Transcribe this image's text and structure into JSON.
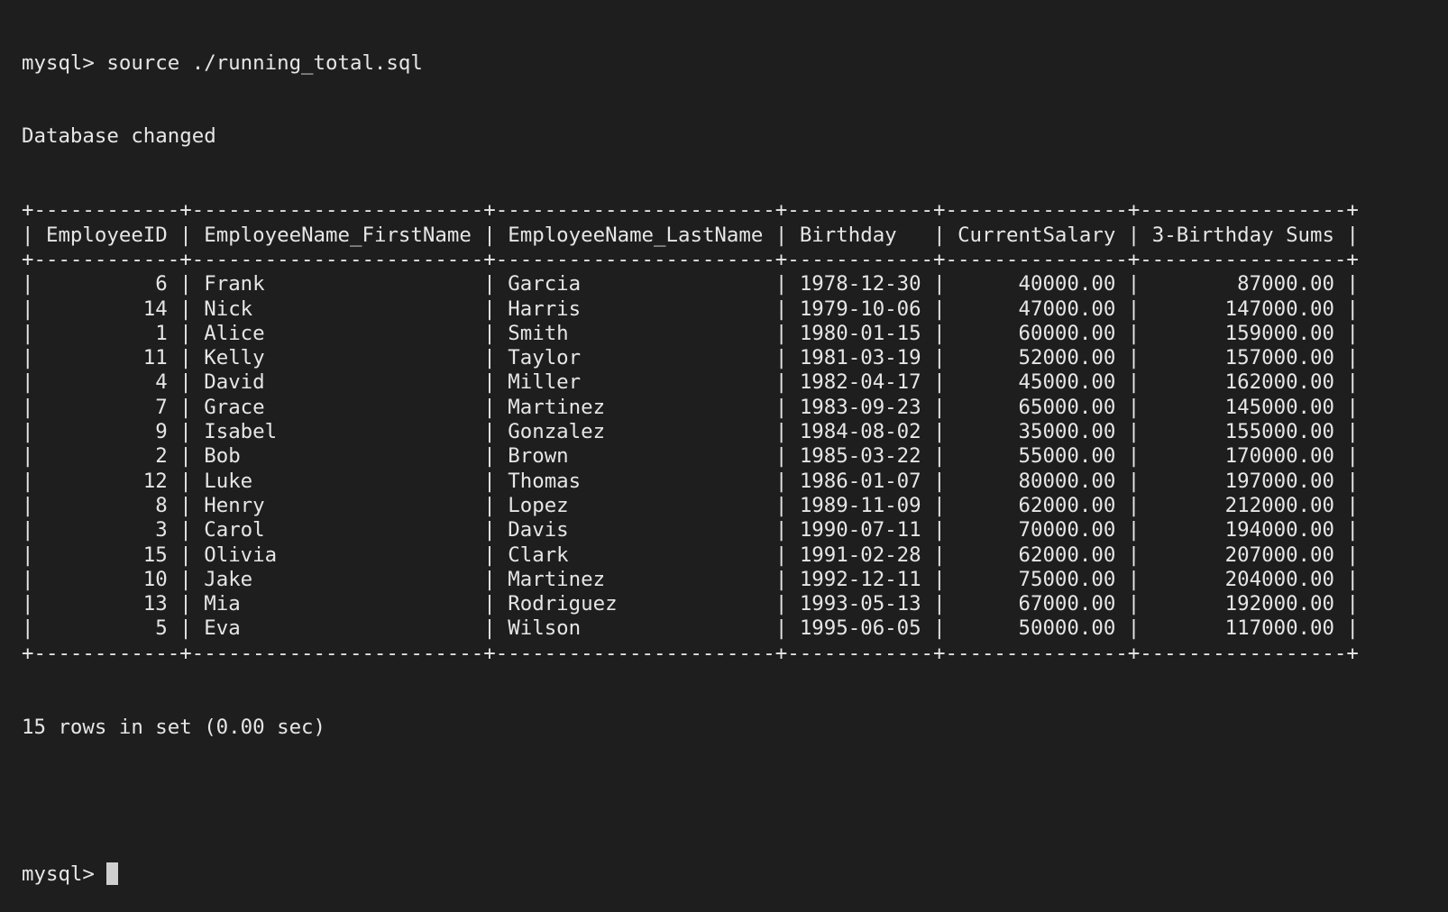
{
  "terminal": {
    "command_line": "mysql> source ./running_total.sql",
    "db_changed": "Database changed",
    "prompt": "mysql> ",
    "summary": "15 rows in set (0.00 sec)"
  },
  "table": {
    "columns": [
      "EmployeeID",
      "EmployeeName_FirstName",
      "EmployeeName_LastName",
      "Birthday",
      "CurrentSalary",
      "3-Birthday Sums"
    ],
    "rows": [
      [
        "6",
        "Frank",
        "Garcia",
        "1978-12-30",
        "40000.00",
        "87000.00"
      ],
      [
        "14",
        "Nick",
        "Harris",
        "1979-10-06",
        "47000.00",
        "147000.00"
      ],
      [
        "1",
        "Alice",
        "Smith",
        "1980-01-15",
        "60000.00",
        "159000.00"
      ],
      [
        "11",
        "Kelly",
        "Taylor",
        "1981-03-19",
        "52000.00",
        "157000.00"
      ],
      [
        "4",
        "David",
        "Miller",
        "1982-04-17",
        "45000.00",
        "162000.00"
      ],
      [
        "7",
        "Grace",
        "Martinez",
        "1983-09-23",
        "65000.00",
        "145000.00"
      ],
      [
        "9",
        "Isabel",
        "Gonzalez",
        "1984-08-02",
        "35000.00",
        "155000.00"
      ],
      [
        "2",
        "Bob",
        "Brown",
        "1985-03-22",
        "55000.00",
        "170000.00"
      ],
      [
        "12",
        "Luke",
        "Thomas",
        "1986-01-07",
        "80000.00",
        "197000.00"
      ],
      [
        "8",
        "Henry",
        "Lopez",
        "1989-11-09",
        "62000.00",
        "212000.00"
      ],
      [
        "3",
        "Carol",
        "Davis",
        "1990-07-11",
        "70000.00",
        "194000.00"
      ],
      [
        "15",
        "Olivia",
        "Clark",
        "1991-02-28",
        "62000.00",
        "207000.00"
      ],
      [
        "10",
        "Jake",
        "Martinez",
        "1992-12-11",
        "75000.00",
        "204000.00"
      ],
      [
        "13",
        "Mia",
        "Rodriguez",
        "1993-05-13",
        "67000.00",
        "192000.00"
      ],
      [
        "5",
        "Eva",
        "Wilson",
        "1995-06-05",
        "50000.00",
        "117000.00"
      ]
    ]
  }
}
